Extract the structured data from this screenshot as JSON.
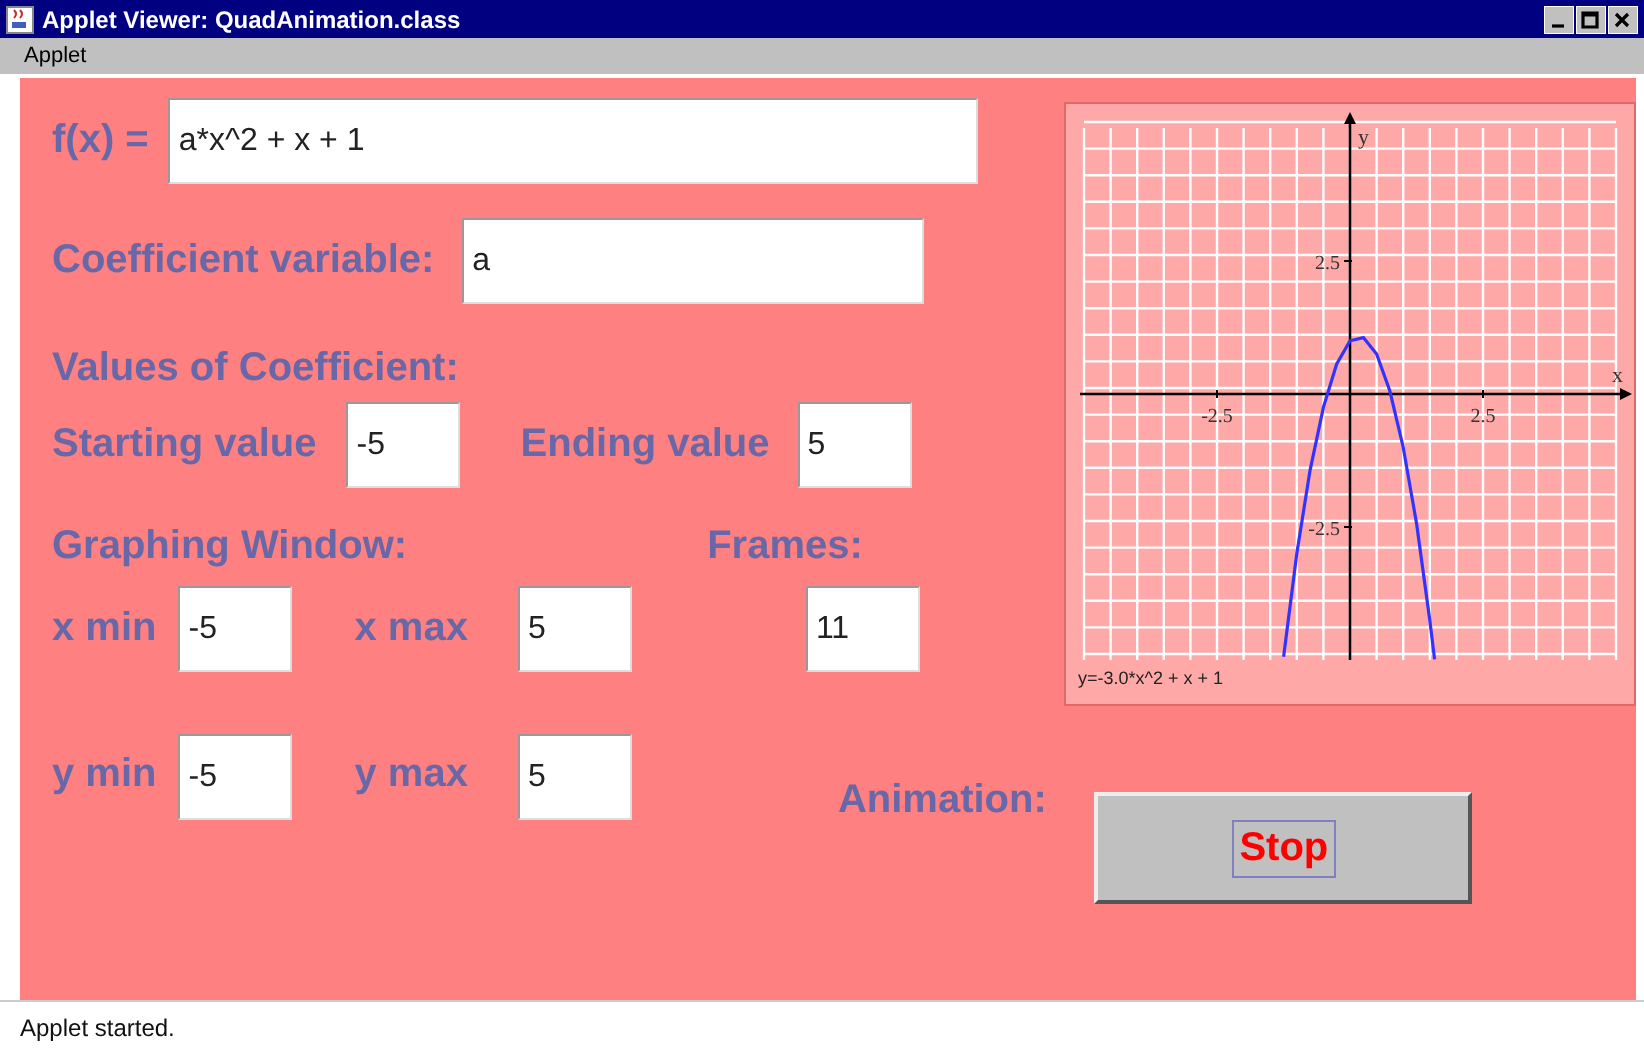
{
  "window": {
    "title": "Applet Viewer: QuadAnimation.class",
    "menu": [
      {
        "label": "Applet"
      }
    ]
  },
  "form": {
    "function": {
      "label": "f(x) =",
      "value": "a*x^2 + x + 1"
    },
    "coefficient_variable": {
      "label": "Coefficient variable:",
      "value": "a"
    },
    "values_heading": "Values of Coefficient:",
    "starting": {
      "label": "Starting value",
      "value": "-5"
    },
    "ending": {
      "label": "Ending value",
      "value": "5"
    },
    "window_heading": "Graphing Window:",
    "frames": {
      "label": "Frames:",
      "value": "11"
    },
    "x_min": {
      "label": "x min",
      "value": "-5"
    },
    "x_max": {
      "label": "x max",
      "value": "5"
    },
    "y_min": {
      "label": "y min",
      "value": "-5"
    },
    "y_max": {
      "label": "y max",
      "value": "5"
    }
  },
  "animation": {
    "label": "Animation:",
    "button": "Stop"
  },
  "graph": {
    "caption": "y=-3.0*x^2 + x + 1",
    "chart_data": {
      "type": "line",
      "xlabel": "x",
      "ylabel": "y",
      "xlim": [
        -5,
        5
      ],
      "ylim": [
        -5,
        5
      ],
      "xticks": [
        -2.5,
        2.5
      ],
      "yticks": [
        -2.5,
        2.5
      ],
      "x": [
        -1.25,
        -1,
        -0.75,
        -0.5,
        -0.25,
        0,
        0.25,
        0.5,
        0.75,
        1,
        1.25,
        1.5,
        1.59
      ],
      "series": [
        {
          "color": "#3333ff",
          "values": [
            -4.94,
            -3,
            -1.44,
            -0.25,
            0.56,
            1,
            1.06,
            0.75,
            0.06,
            -1,
            -2.44,
            -4.25,
            -4.99
          ]
        }
      ]
    }
  },
  "status_bar": "Applet started."
}
